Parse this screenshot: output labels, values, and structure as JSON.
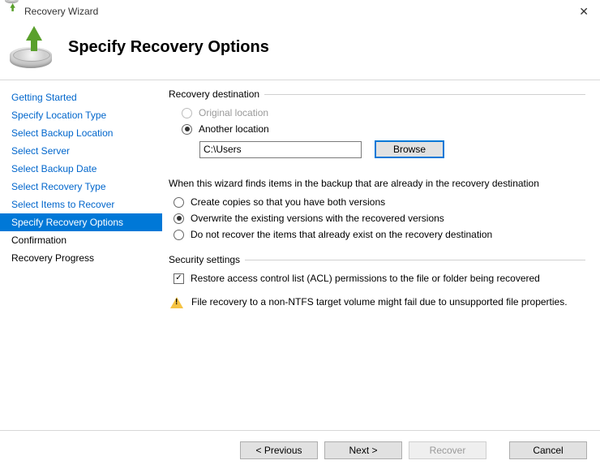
{
  "window": {
    "title": "Recovery Wizard",
    "close_glyph": "✕"
  },
  "header": {
    "page_title": "Specify Recovery Options"
  },
  "sidebar": {
    "steps": [
      "Getting Started",
      "Specify Location Type",
      "Select Backup Location",
      "Select Server",
      "Select Backup Date",
      "Select Recovery Type",
      "Select Items to Recover",
      "Specify Recovery Options",
      "Confirmation",
      "Recovery Progress"
    ],
    "active_index": 7
  },
  "destination": {
    "group_label": "Recovery destination",
    "original_location_label": "Original location",
    "another_location_label": "Another location",
    "selected": "another",
    "path_value": "C:\\Users",
    "browse_label": "Browse"
  },
  "conflict": {
    "group_label": "When this wizard finds items in the backup that are already in the recovery destination",
    "create_copies_label": "Create copies so that you have both versions",
    "overwrite_label": "Overwrite the existing versions with the recovered versions",
    "skip_label": "Do not recover the items that already exist on the recovery destination",
    "selected": "overwrite"
  },
  "security": {
    "group_label": "Security settings",
    "acl_label": "Restore access control list (ACL) permissions to the file or folder being recovered",
    "acl_checked": true
  },
  "warning": {
    "text": "File recovery to a non-NTFS target volume might fail due to unsupported file properties."
  },
  "footer": {
    "previous_label": "< Previous",
    "next_label": "Next >",
    "recover_label": "Recover",
    "cancel_label": "Cancel"
  }
}
